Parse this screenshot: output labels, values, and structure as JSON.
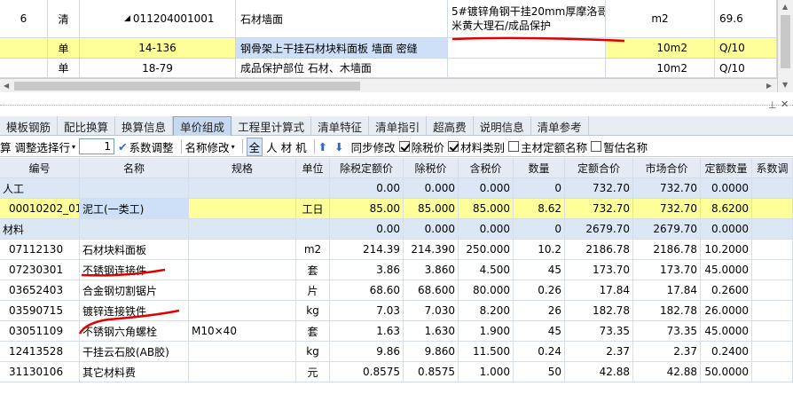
{
  "top_grid": {
    "rows": [
      {
        "seq": "6",
        "type": "清",
        "code": "011204001001",
        "name": "石材墙面",
        "feature_line1": "5#镀锌角钢干挂20mm厚摩洛哥",
        "feature_line2": "米黄大理石/成品保护",
        "unit": "m2",
        "qty": "69.6"
      },
      {
        "seq": "",
        "type": "单",
        "code": "14-136",
        "name": "钢骨架上干挂石材块料面板 墙面 密缝",
        "feature_line1": "",
        "feature_line2": "",
        "unit": "10m2",
        "qty": "Q/10"
      },
      {
        "seq": "",
        "type": "单",
        "code": "18-79",
        "name": "成品保护部位 石材、木墙面",
        "feature_line1": "",
        "feature_line2": "",
        "unit": "10m2",
        "qty": "Q/10"
      }
    ]
  },
  "tabs": [
    "模板钢筋",
    "配比换算",
    "换算信息",
    "单价组成",
    "工程里计算式",
    "清单特征",
    "清单指引",
    "超高费",
    "说明信息",
    "清单参考"
  ],
  "active_tab": "单价组成",
  "toolbar": {
    "calc_label": "算",
    "adjust_selected_label": "调整选择行",
    "coef_value": "1",
    "coef_adjust_label": "系数调整",
    "name_modify_label": "名称修改",
    "filter_all": "全",
    "filter_labor": "人",
    "filter_material": "材",
    "filter_machine": "机",
    "sync_modify_label": "同步修改",
    "exclude_tax_label": "除税价",
    "material_category_label": "材料类别",
    "main_material_name_label": "主材定额名称",
    "temp_name_label": "暂估名称"
  },
  "bottom_grid": {
    "headers": [
      "编号",
      "名称",
      "规格",
      "单位",
      "除税定额价",
      "除税价",
      "含税价",
      "数量",
      "定额合价",
      "市场合价",
      "定额数量",
      "系数调"
    ],
    "rows": [
      {
        "kind": "cat",
        "code": "人工",
        "name": "",
        "spec": "",
        "unit": "",
        "p1": "0.00",
        "p2": "0.000",
        "p3": "0.000",
        "qty": "0",
        "sum1": "732.70",
        "sum2": "732.70",
        "dq": "0.0000"
      },
      {
        "kind": "sel",
        "code": "00010202_01",
        "name": "泥工(一类工)",
        "spec": "",
        "unit": "工日",
        "p1": "85.00",
        "p2": "85.000",
        "p3": "85.000",
        "qty": "8.62",
        "sum1": "732.70",
        "sum2": "732.70",
        "dq": "8.6200"
      },
      {
        "kind": "cat",
        "code": "材料",
        "name": "",
        "spec": "",
        "unit": "",
        "p1": "0.00",
        "p2": "0.000",
        "p3": "0.000",
        "qty": "0",
        "sum1": "2679.70",
        "sum2": "2679.70",
        "dq": "0.0000"
      },
      {
        "kind": "norm",
        "code": "07112130",
        "name": "石材块料面板",
        "spec": "",
        "unit": "m2",
        "p1": "214.39",
        "p2": "214.390",
        "p3": "250.000",
        "qty": "10.2",
        "sum1": "2186.78",
        "sum2": "2186.78",
        "dq": "10.2000"
      },
      {
        "kind": "norm",
        "code": "07230301",
        "name": "不锈钢连接件",
        "spec": "",
        "unit": "套",
        "p1": "3.86",
        "p2": "3.860",
        "p3": "4.500",
        "qty": "45",
        "sum1": "173.70",
        "sum2": "173.70",
        "dq": "45.0000"
      },
      {
        "kind": "norm",
        "code": "03652403",
        "name": "合金钢切割锯片",
        "spec": "",
        "unit": "片",
        "p1": "68.60",
        "p2": "68.600",
        "p3": "80.000",
        "qty": "0.26",
        "sum1": "17.84",
        "sum2": "17.84",
        "dq": "0.2600"
      },
      {
        "kind": "norm",
        "code": "03590715",
        "name": "镀锌连接铁件",
        "spec": "",
        "unit": "kg",
        "p1": "7.03",
        "p2": "7.030",
        "p3": "8.200",
        "qty": "26",
        "sum1": "182.78",
        "sum2": "182.78",
        "dq": "26.0000"
      },
      {
        "kind": "norm",
        "code": "03051109",
        "name": "不锈钢六角螺栓",
        "spec": "M10×40",
        "unit": "套",
        "p1": "1.63",
        "p2": "1.630",
        "p3": "1.900",
        "qty": "45",
        "sum1": "73.35",
        "sum2": "73.35",
        "dq": "45.0000"
      },
      {
        "kind": "norm",
        "code": "12413528",
        "name": "干挂云石胶(AB胶)",
        "spec": "",
        "unit": "kg",
        "p1": "9.86",
        "p2": "9.860",
        "p3": "11.500",
        "qty": "0.24",
        "sum1": "2.37",
        "sum2": "2.37",
        "dq": "0.2400"
      },
      {
        "kind": "norm",
        "code": "31130106",
        "name": "其它材料费",
        "spec": "",
        "unit": "元",
        "p1": "0.8575",
        "p2": "0.8575",
        "p3": "1.000",
        "qty": "50",
        "sum1": "42.88",
        "sum2": "42.88",
        "dq": "50.0000"
      }
    ]
  },
  "colors": {
    "selected_row": "#ffff99",
    "header_bg": "#e4ebf5",
    "category_row": "#dbe7f5",
    "annotation": "#e00000"
  }
}
